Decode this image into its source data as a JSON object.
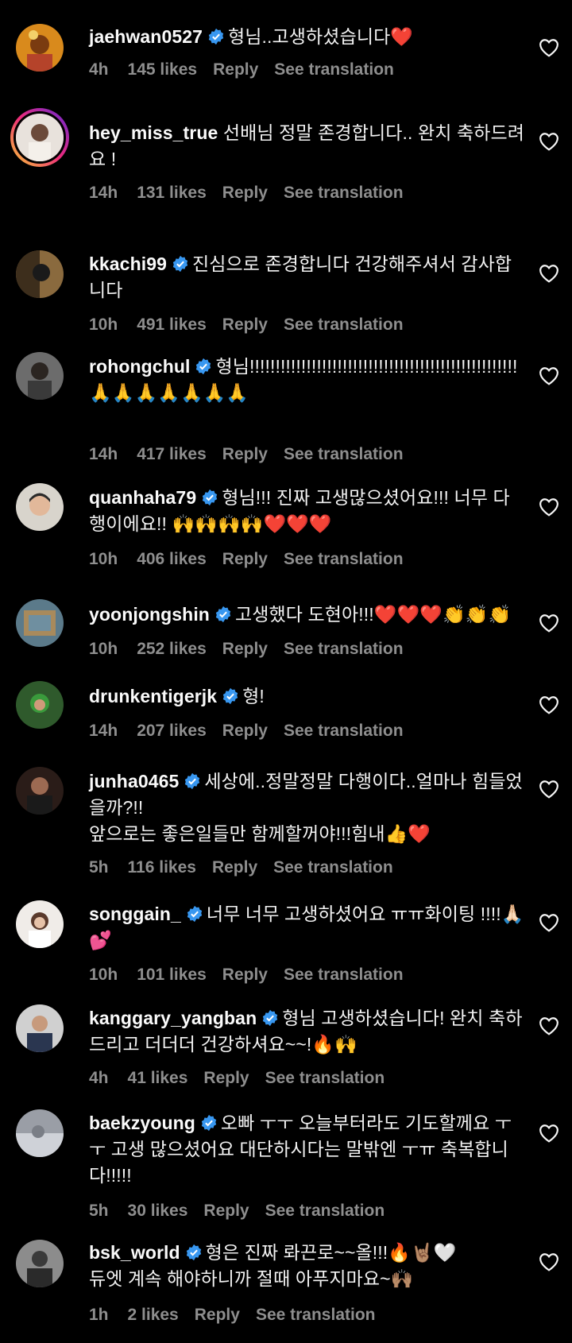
{
  "actions": {
    "reply": "Reply",
    "translate": "See translation"
  },
  "comments": [
    {
      "username": "jaehwan0527",
      "verified": true,
      "text": "형님..고생하셨습니다❤️",
      "time": "4h",
      "likes": "145 likes"
    },
    {
      "username": "hey_miss_true",
      "verified": false,
      "text": "선배님 정말 존경합니다.. 완치 축하드려요 !",
      "time": "14h",
      "likes": "131 likes"
    },
    {
      "username": "kkachi99",
      "verified": true,
      "text": "진심으로 존경합니다 건강해주셔서 감사합니다",
      "time": "10h",
      "likes": "491 likes"
    },
    {
      "username": "rohongchul",
      "verified": true,
      "text": "형님!!!!!!!!!!!!!!!!!!!!!!!!!!!!!!!!!!!!!!!!!!!!!!!!!!!!🙏🙏🙏🙏🙏🙏🙏",
      "time": "14h",
      "likes": "417 likes"
    },
    {
      "username": "quanhaha79",
      "verified": true,
      "text": "형님!!! 진짜 고생많으셨어요!!! 너무 다행이에요!! 🙌🙌🙌🙌❤️❤️❤️",
      "time": "10h",
      "likes": "406 likes"
    },
    {
      "username": "yoonjongshin",
      "verified": true,
      "text": "고생했다 도현아!!!❤️❤️❤️👏👏👏",
      "time": "10h",
      "likes": "252 likes"
    },
    {
      "username": "drunkentigerjk",
      "verified": true,
      "text": "형!",
      "time": "14h",
      "likes": "207 likes"
    },
    {
      "username": "junha0465",
      "verified": true,
      "text": "세상에..정말정말 다행이다..얼마나 힘들었을까?!!\n앞으로는 좋은일들만 함께할꺼야!!!힘내👍❤️",
      "time": "5h",
      "likes": "116 likes"
    },
    {
      "username": "songgain_",
      "verified": true,
      "text": "너무 너무 고생하셨어요 ㅠㅠ화이팅 !!!!🙏🏻💕",
      "time": "10h",
      "likes": "101 likes"
    },
    {
      "username": "kanggary_yangban",
      "verified": true,
      "text": "형님 고생하셨습니다! 완치 축하드리고 더더더 건강하셔요~~!🔥🙌",
      "time": "4h",
      "likes": "41 likes"
    },
    {
      "username": "baekzyoung",
      "verified": true,
      "text": "오빠 ㅜㅜ 오늘부터라도 기도할께요 ㅜㅜ 고생 많으셨어요 대단하시다는 말밖엔 ㅜㅠ 축복합니다!!!!!",
      "time": "5h",
      "likes": "30 likes"
    },
    {
      "username": "bsk_world",
      "verified": true,
      "text": "형은 진짜 롸끈로~~올!!!🔥🤘🏽🤍\n듀엣 계속 해야하니까 절때 아푸지마요~🙌🏽",
      "time": "1h",
      "likes": "2 likes"
    }
  ],
  "colors": {
    "background": "#000000",
    "text": "#f5f5f5",
    "meta": "#8e8e8e",
    "verified": "#3897f0"
  },
  "icons": {
    "like": "heart-outline-icon",
    "verified": "verified-badge-icon"
  }
}
